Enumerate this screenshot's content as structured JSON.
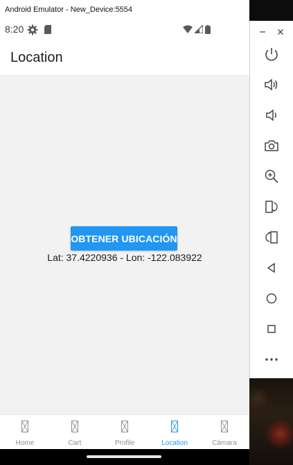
{
  "emulator": {
    "window_title": "Android Emulator - New_Device:5554",
    "toolbar": {
      "minimize_label": "−",
      "close_label": "×"
    }
  },
  "statusbar": {
    "time": "8:20"
  },
  "appbar": {
    "title": "Location"
  },
  "content": {
    "button_label": "OBTENER UBICACIÓN",
    "coordinates_text": "Lat: 37.4220936 - Lon: -122.083922"
  },
  "tabs": [
    {
      "label": "Home",
      "active": false
    },
    {
      "label": "Cart",
      "active": false
    },
    {
      "label": "Profile",
      "active": false
    },
    {
      "label": "Location",
      "active": true
    },
    {
      "label": "Cámara",
      "active": false
    }
  ],
  "colors": {
    "accent": "#2196f3",
    "inactive_tab": "#8e8e93",
    "content_bg": "#f2f2f2"
  }
}
